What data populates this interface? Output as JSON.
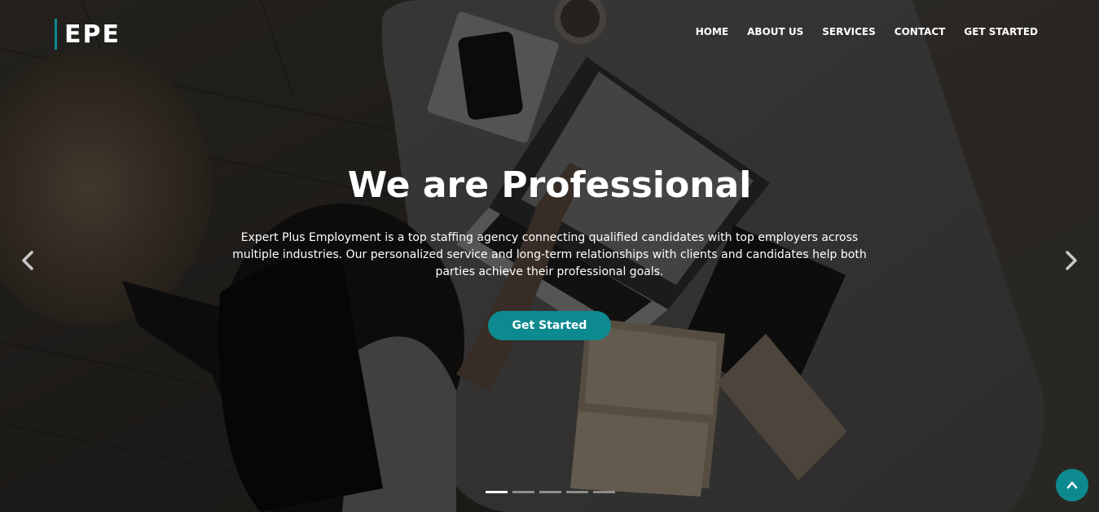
{
  "logo": {
    "text": "EPE"
  },
  "nav": {
    "items": [
      {
        "label": "HOME"
      },
      {
        "label": "ABOUT US"
      },
      {
        "label": "SERVICES"
      },
      {
        "label": "CONTACT"
      },
      {
        "label": "GET STARTED"
      }
    ]
  },
  "hero": {
    "title": "We are Professional",
    "description": "Expert Plus Employment is a top staffing agency connecting qualified candidates with top employers across multiple industries. Our personalized service and long-term relationships with clients and candidates help both parties achieve their professional goals.",
    "cta_label": "Get Started"
  },
  "carousel": {
    "slide_count": 5,
    "active_index": 0,
    "prev_icon": "chevron-left-icon",
    "next_icon": "chevron-right-icon"
  },
  "back_to_top": {
    "icon": "chevron-up-icon"
  },
  "colors": {
    "accent": "#0d8a8f",
    "text": "#ffffff"
  }
}
